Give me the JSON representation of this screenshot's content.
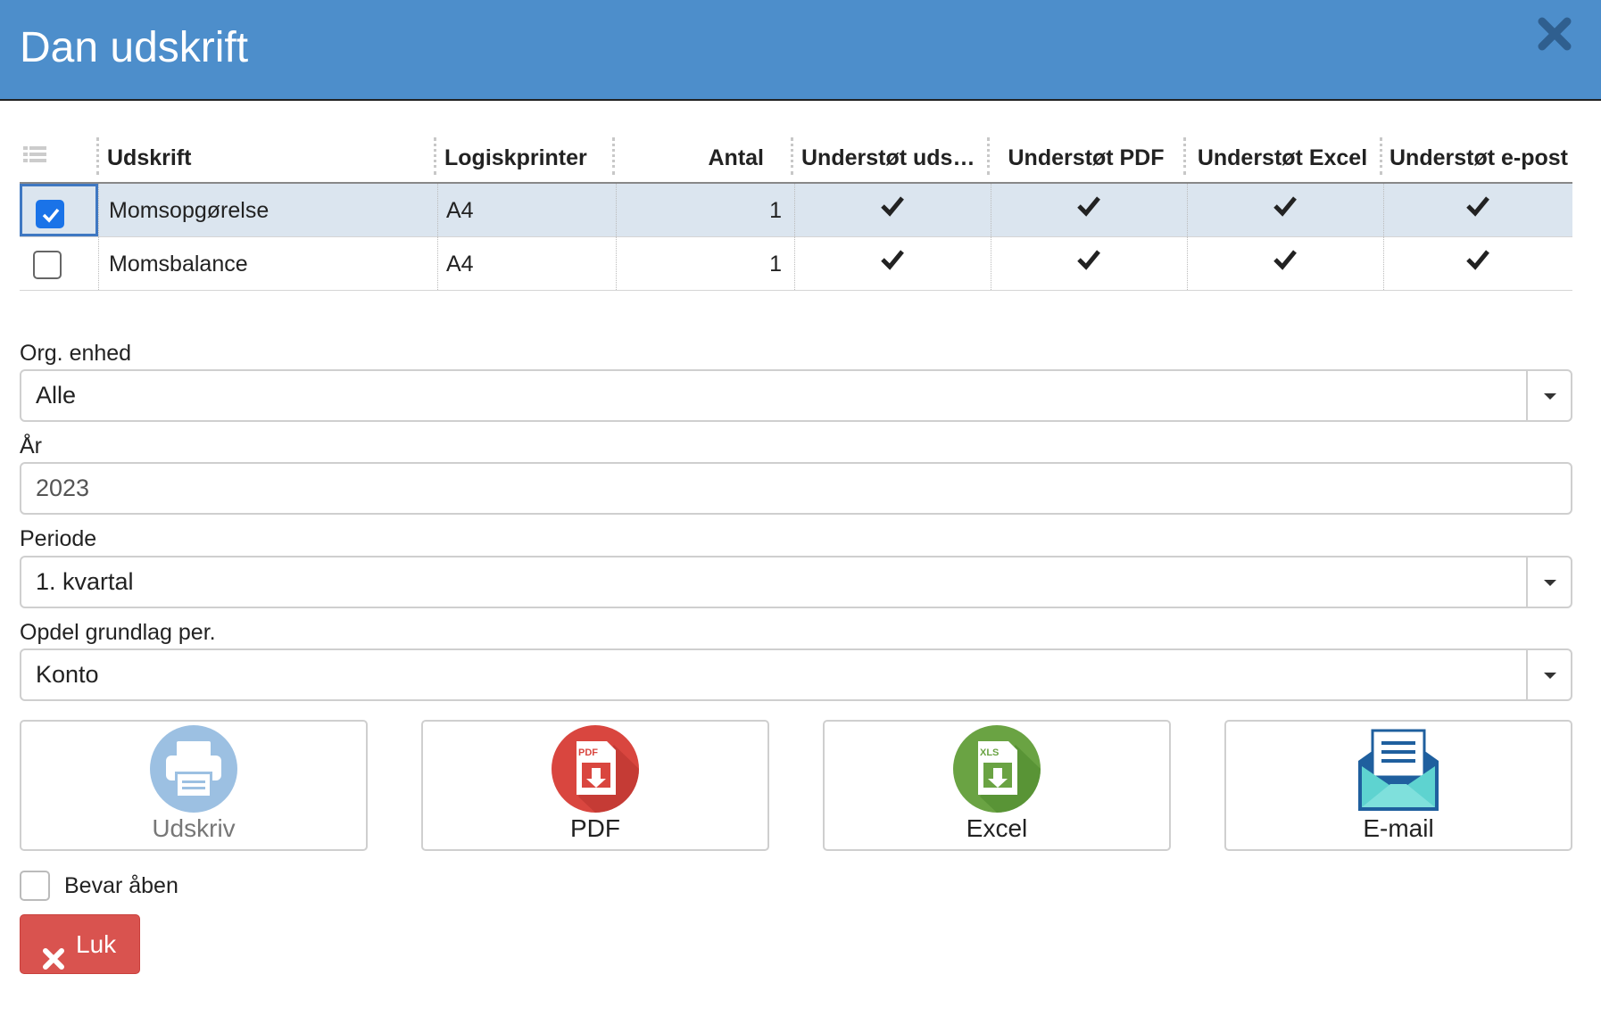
{
  "dialog": {
    "title": "Dan udskrift",
    "header_color": "#4d8ecb"
  },
  "table": {
    "columns": [
      "Udskrift",
      "Logiskprinter",
      "Antal",
      "Understøt uds…",
      "Understøt PDF",
      "Understøt Excel",
      "Understøt e-post"
    ],
    "rows": [
      {
        "selected": true,
        "name": "Momsopgørelse",
        "printer": "A4",
        "antal": "1",
        "print": true,
        "pdf": true,
        "excel": true,
        "email": true
      },
      {
        "selected": false,
        "name": "Momsbalance",
        "printer": "A4",
        "antal": "1",
        "print": true,
        "pdf": true,
        "excel": true,
        "email": true
      }
    ]
  },
  "form": {
    "org_label": "Org. enhed",
    "org_value": "Alle",
    "year_label": "År",
    "year_value": "2023",
    "period_label": "Periode",
    "period_value": "1. kvartal",
    "split_label": "Opdel grundlag per.",
    "split_value": "Konto"
  },
  "actions": {
    "print": {
      "label": "Udskriv",
      "icon": "printer-icon",
      "enabled": false
    },
    "pdf": {
      "label": "PDF",
      "icon": "pdf-icon",
      "enabled": true
    },
    "excel": {
      "label": "Excel",
      "icon": "excel-icon",
      "enabled": true
    },
    "email": {
      "label": "E-mail",
      "icon": "email-icon",
      "enabled": true
    }
  },
  "footer": {
    "keep_open_label": "Bevar åben",
    "keep_open_checked": false,
    "close_label": "Luk",
    "close_color": "#d9534f"
  }
}
